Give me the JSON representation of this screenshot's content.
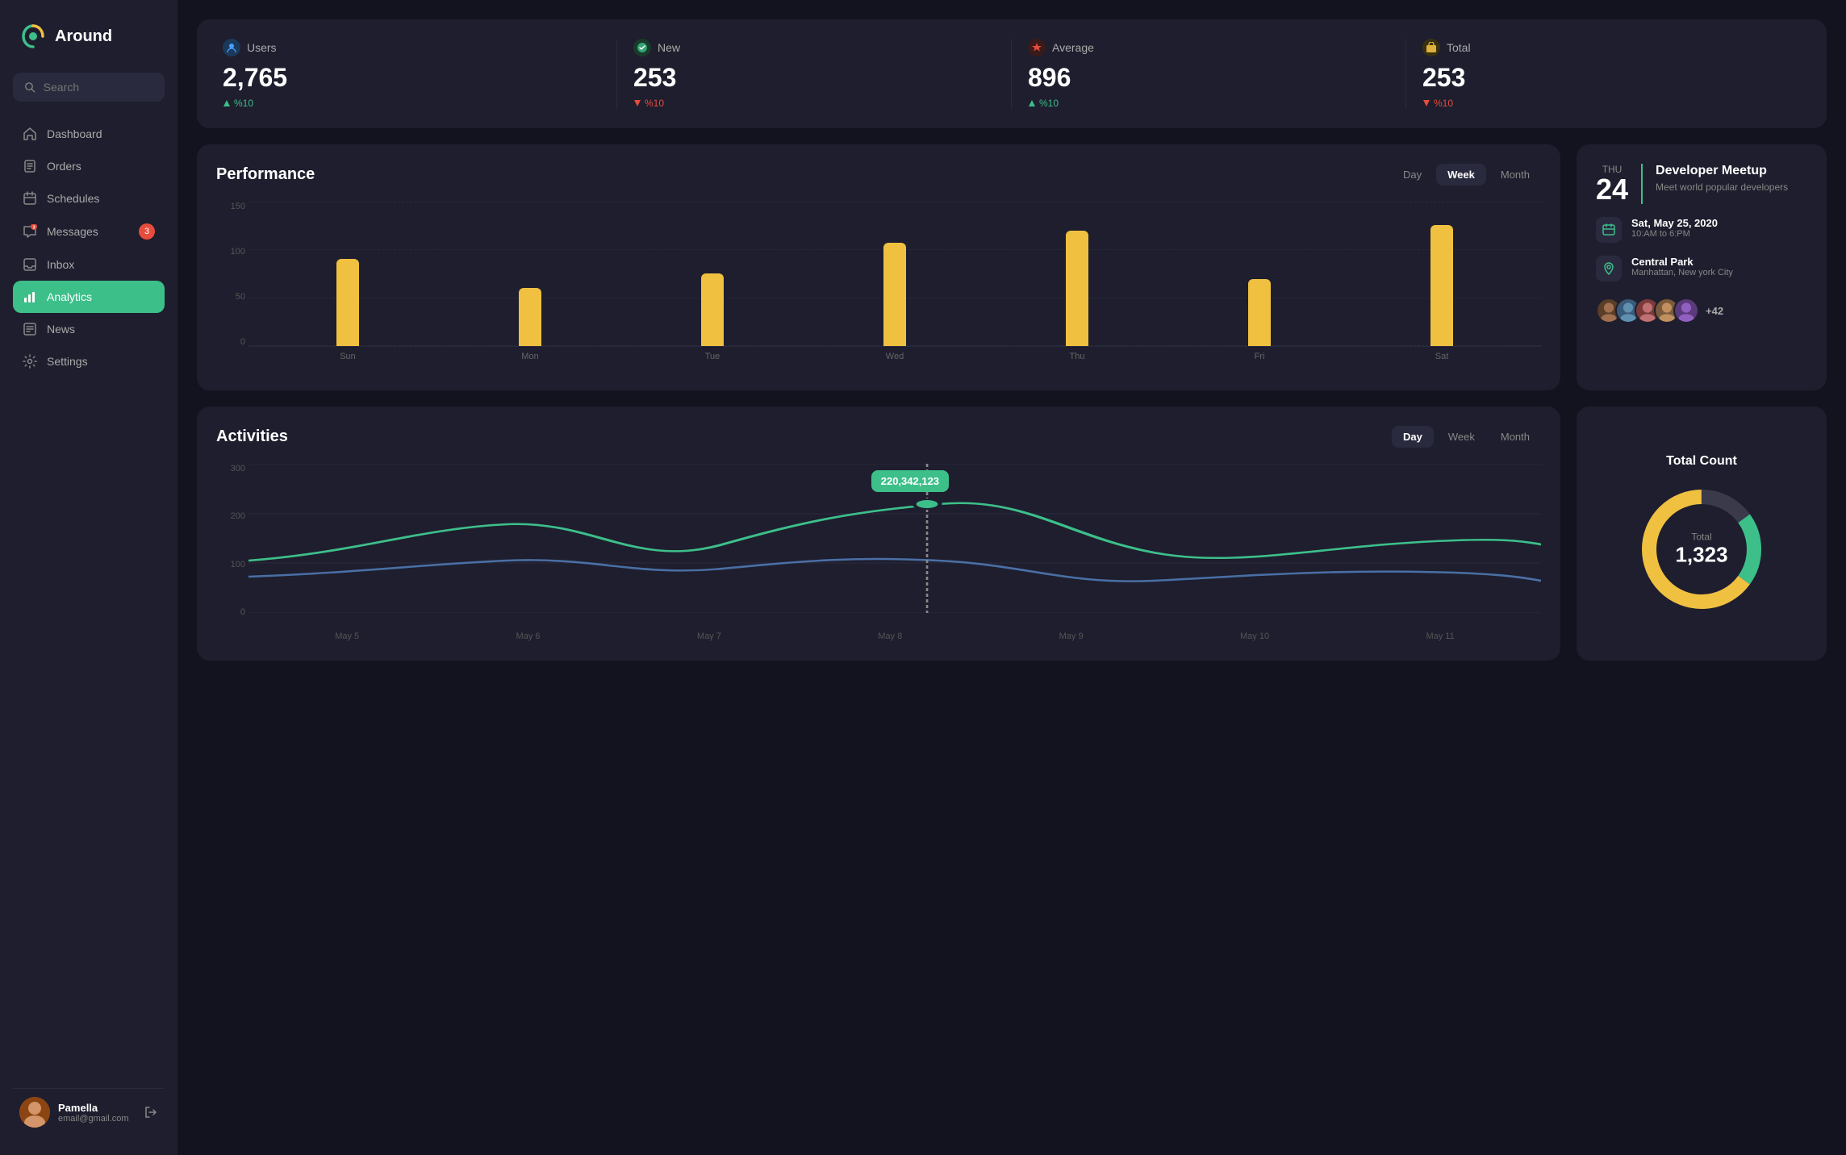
{
  "app": {
    "name": "Around",
    "logo_alt": "around-logo"
  },
  "sidebar": {
    "search_placeholder": "Search",
    "nav_items": [
      {
        "id": "dashboard",
        "label": "Dashboard",
        "icon": "home-icon",
        "active": false,
        "badge": null
      },
      {
        "id": "orders",
        "label": "Orders",
        "icon": "orders-icon",
        "active": false,
        "badge": null
      },
      {
        "id": "schedules",
        "label": "Schedules",
        "icon": "schedules-icon",
        "active": false,
        "badge": null
      },
      {
        "id": "messages",
        "label": "Messages",
        "icon": "messages-icon",
        "active": false,
        "badge": "3"
      },
      {
        "id": "inbox",
        "label": "Inbox",
        "icon": "inbox-icon",
        "active": false,
        "badge": null
      },
      {
        "id": "analytics",
        "label": "Analytics",
        "icon": "analytics-icon",
        "active": true,
        "badge": null
      },
      {
        "id": "news",
        "label": "News",
        "icon": "news-icon",
        "active": false,
        "badge": null
      },
      {
        "id": "settings",
        "label": "Settings",
        "icon": "settings-icon",
        "active": false,
        "badge": null
      }
    ],
    "user": {
      "name": "Pamella",
      "email": "email@gmail.com"
    }
  },
  "stats": [
    {
      "label": "Users",
      "value": "2,765",
      "change": "%10",
      "trend": "up",
      "icon_color": "#4a9eff"
    },
    {
      "label": "New",
      "value": "253",
      "change": "%10",
      "trend": "down",
      "icon_color": "#3dbf8a"
    },
    {
      "label": "Average",
      "value": "896",
      "change": "%10",
      "trend": "up",
      "icon_color": "#e74c3c"
    },
    {
      "label": "Total",
      "value": "253",
      "change": "%10",
      "trend": "down",
      "icon_color": "#f0c040"
    }
  ],
  "performance": {
    "title": "Performance",
    "time_tabs": [
      "Day",
      "Week",
      "Month"
    ],
    "active_tab": "Week",
    "bars": [
      {
        "label": "Sun",
        "height_pct": 72
      },
      {
        "label": "Mon",
        "height_pct": 48
      },
      {
        "label": "Tue",
        "height_pct": 60
      },
      {
        "label": "Wed",
        "height_pct": 85
      },
      {
        "label": "Thu",
        "height_pct": 95
      },
      {
        "label": "Fri",
        "height_pct": 55
      },
      {
        "label": "Sat",
        "height_pct": 100
      }
    ],
    "y_labels": [
      "150",
      "100",
      "50",
      "0"
    ]
  },
  "event": {
    "day_name": "THU",
    "day_num": "24",
    "title": "Developer Meetup",
    "subtitle": "Meet world popular developers",
    "date_label": "Sat, May 25, 2020",
    "time_label": "10:AM to 6:PM",
    "location_main": "Central Park",
    "location_sub": "Manhattan, New york City",
    "attendees_extra": "+42"
  },
  "activities": {
    "title": "Activities",
    "time_tabs": [
      "Day",
      "Week",
      "Month"
    ],
    "active_tab": "Day",
    "tooltip_value": "220,342,123",
    "x_labels": [
      "May 5",
      "May 6",
      "May 7",
      "May 8",
      "May 9",
      "May 10",
      "May 11"
    ],
    "y_labels": [
      "300",
      "200",
      "100",
      "0"
    ]
  },
  "total_count": {
    "title": "Total Count",
    "label": "Total",
    "value": "1,323",
    "donut": {
      "yellow_pct": 65,
      "green_pct": 20,
      "gray_pct": 15
    }
  }
}
